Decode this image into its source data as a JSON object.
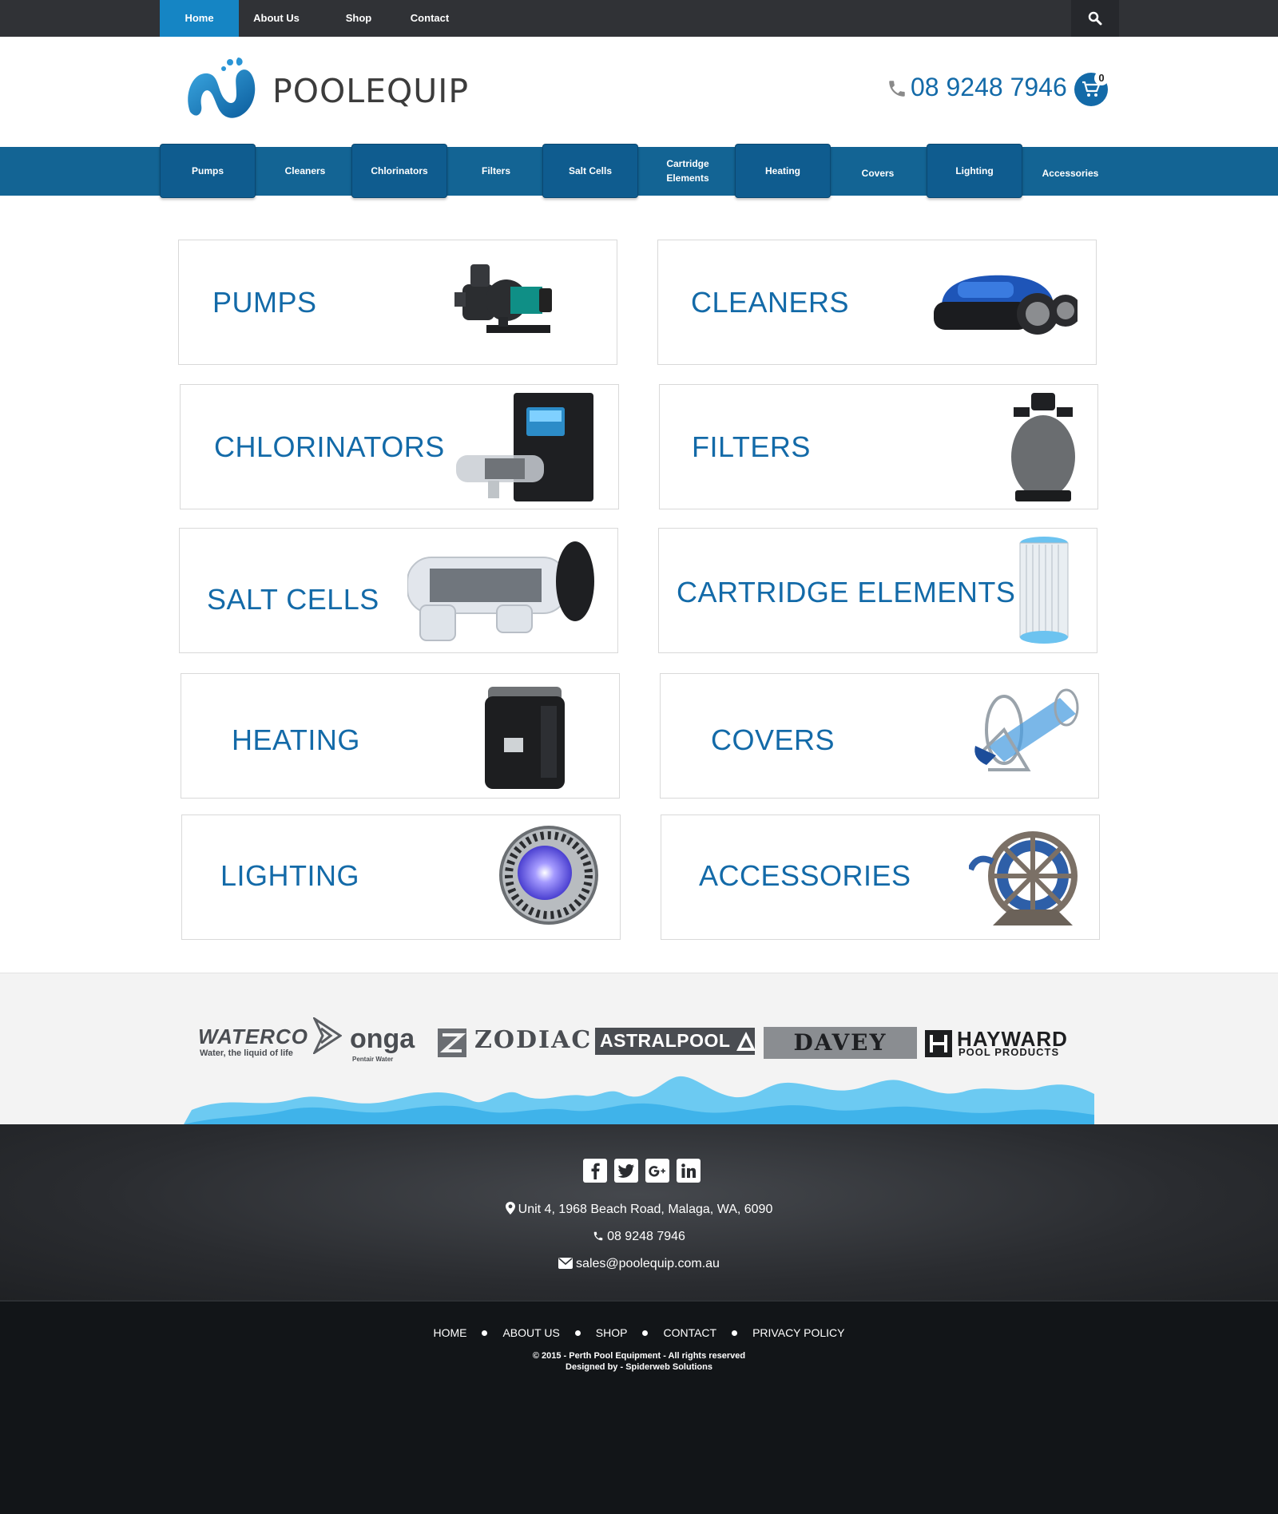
{
  "topnav": {
    "items": [
      "Home",
      "About Us",
      "Shop",
      "Contact"
    ]
  },
  "header": {
    "brand": "POOLEQUIP",
    "phone": "08 9248 7946",
    "cart_count": "0"
  },
  "catnav": {
    "items": [
      "Pumps",
      "Cleaners",
      "Chlorinators",
      "Filters",
      "Salt Cells",
      "Cartridge Elements",
      "Heating",
      "Covers",
      "Lighting",
      "Accessories"
    ]
  },
  "cards": [
    "PUMPS",
    "CLEANERS",
    "CHLORINATORS",
    "FILTERS",
    "SALT CELLS",
    "CARTRIDGE ELEMENTS",
    "HEATING",
    "COVERS",
    "LIGHTING",
    "ACCESSORIES"
  ],
  "brands": {
    "waterco": "WATERCO",
    "waterco_tag": "Water, the liquid of life",
    "onga": "onga",
    "onga_tag": "Pentair Water",
    "zodiac": "ZODIAC",
    "astral": "ASTRALPOOL",
    "davey": "DAVEY",
    "hayward": "HAYWARD",
    "hayward_tag": "POOL PRODUCTS"
  },
  "footer": {
    "address": "Unit 4, 1968 Beach Road, Malaga, WA, 6090",
    "phone": "08 9248 7946",
    "email": "sales@poolequip.com.au",
    "links": [
      "HOME",
      "ABOUT US",
      "SHOP",
      "CONTACT",
      "PRIVACY POLICY"
    ],
    "copyright": "© 2015 - Perth Pool Equipment - All rights reserved",
    "designed_by": "Designed by - Spiderweb Solutions"
  },
  "colors": {
    "accent": "#1585c4",
    "brand_blue": "#136aa8",
    "nav_blue": "#136494",
    "topbar": "#303236",
    "footer_dark": "#121518"
  },
  "icons": [
    "search-icon",
    "phone-icon",
    "cart-icon",
    "facebook-icon",
    "twitter-icon",
    "google-plus-icon",
    "linkedin-icon",
    "map-marker-icon",
    "envelope-icon"
  ]
}
